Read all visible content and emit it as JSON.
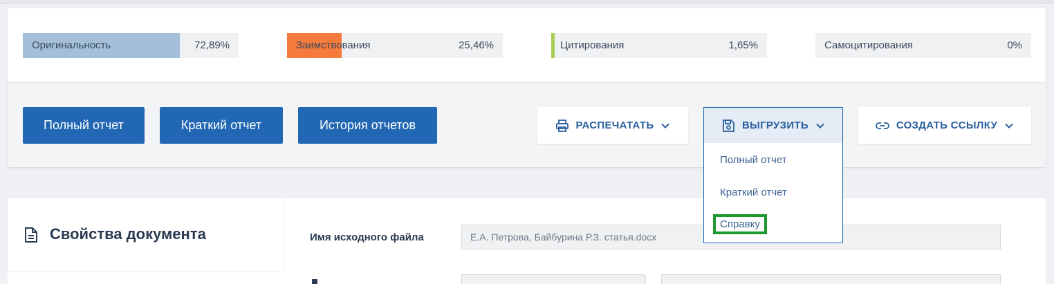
{
  "stats": [
    {
      "label": "Оригинальность",
      "value": "72,89%",
      "percent": 72.89,
      "color": "#a3bfd9"
    },
    {
      "label": "Заимствования",
      "value": "25,46%",
      "percent": 25.46,
      "color": "#f47b3b"
    },
    {
      "label": "Цитирования",
      "value": "1,65%",
      "percent": 1.65,
      "color": "#a6cd57"
    },
    {
      "label": "Самоцитирования",
      "value": "0%",
      "percent": 0,
      "color": "#f0f1f3"
    }
  ],
  "buttons": {
    "full_report": "Полный отчет",
    "short_report": "Краткий отчет",
    "history": "История отчетов",
    "print": "РАСПЕЧАТАТЬ",
    "export": "ВЫГРУЗИТЬ",
    "create_link": "СОЗДАТЬ ССЫЛКУ"
  },
  "export_menu": {
    "items": [
      "Полный отчет",
      "Краткий отчет",
      "Справку"
    ]
  },
  "properties": {
    "title": "Свойства документа",
    "source_file_label": "Имя исходного файла",
    "source_file_value": "Е.А. Петрова, Байбурина Р.З. статья.docx"
  },
  "icons": {
    "print": "printer-icon",
    "export": "save-icon",
    "link": "link-icon",
    "chevron": "chevron-down-icon",
    "document": "document-icon"
  },
  "colors": {
    "primary": "#2267b3",
    "highlight": "#1c9a2e"
  }
}
